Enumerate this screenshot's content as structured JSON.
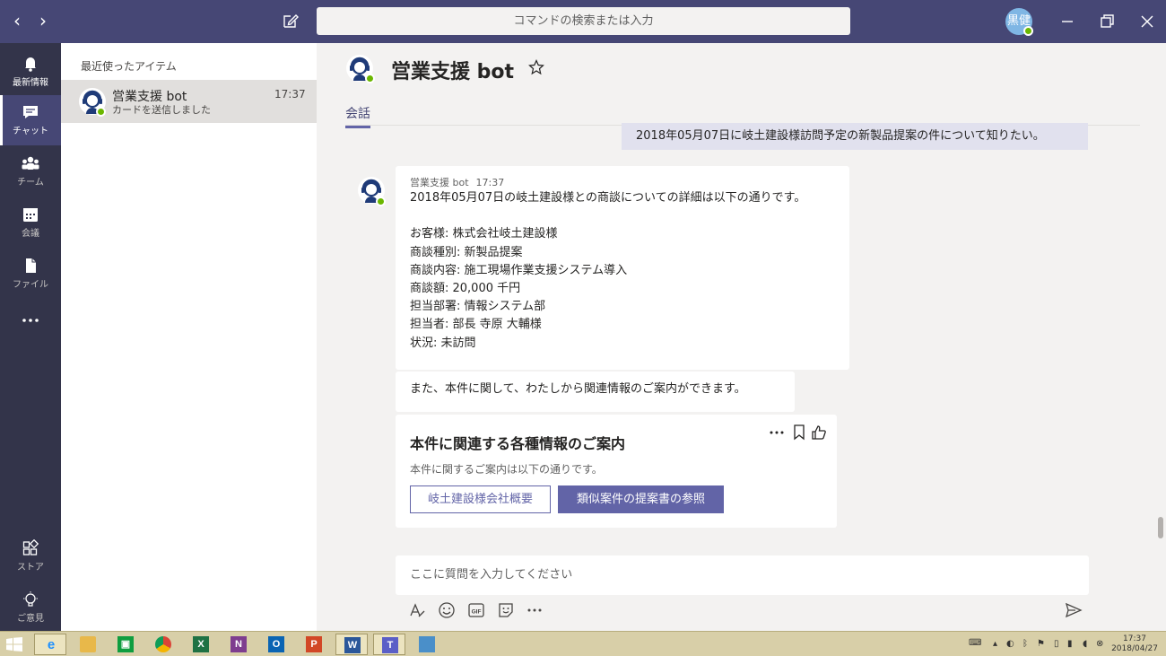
{
  "titlebar": {
    "search_placeholder": "コマンドの検索または入力",
    "user_initials": "黒健"
  },
  "rail": {
    "items": [
      {
        "label": "最新情報",
        "icon": "bell-icon"
      },
      {
        "label": "チャット",
        "icon": "chat-icon",
        "active": true
      },
      {
        "label": "チーム",
        "icon": "teams-icon"
      },
      {
        "label": "会議",
        "icon": "calendar-icon"
      },
      {
        "label": "ファイル",
        "icon": "file-icon"
      },
      {
        "label": "…",
        "icon": "more-icon"
      }
    ],
    "bottom": [
      {
        "label": "ストア",
        "icon": "store-icon"
      },
      {
        "label": "ご意見",
        "icon": "feedback-icon"
      }
    ]
  },
  "chatlist": {
    "header": "最近使ったアイテム",
    "items": [
      {
        "name": "営業支援 bot",
        "preview": "カードを送信しました",
        "time": "17:37"
      }
    ]
  },
  "conversation": {
    "title": "営業支援 bot",
    "tab": "会話",
    "my_message": "2018年05月07日に岐土建設様訪問予定の新製品提案の件について知りたい。",
    "bot_message": {
      "sender": "営業支援 bot",
      "time": "17:37",
      "lines": [
        "2018年05月07日の岐土建設様との商談についての詳細は以下の通りです。",
        "",
        "お客様: 株式会社岐土建設様",
        "商談種別: 新製品提案",
        "商談内容: 施工現場作業支援システム導入",
        "商談額: 20,000 千円",
        "担当部署: 情報システム部",
        "担当者: 部長 寺原 大輔様",
        "状況: 未訪問"
      ]
    },
    "bot_message2": "また、本件に関して、わたしから関連情報のご案内ができます。",
    "card": {
      "title": "本件に関連する各種情報のご案内",
      "subtitle": "本件に関するご案内は以下の通りです。",
      "button1": "岐土建設様会社概要",
      "button2": "類似案件の提案書の参照"
    },
    "composer_placeholder": "ここに質問を入力してください"
  },
  "taskbar": {
    "apps": [
      "ie-icon",
      "explorer-icon",
      "store-icon",
      "chrome-icon",
      "excel-icon",
      "onenote-icon",
      "outlook-icon",
      "powerpoint-icon",
      "word-icon",
      "teams-icon",
      "remote-desktop-icon"
    ],
    "time": "17:37",
    "date": "2018/04/27"
  },
  "colors": {
    "titlebar": "#464775",
    "rail": "#33344a",
    "accent": "#6264a7",
    "presence": "#6bb700"
  }
}
